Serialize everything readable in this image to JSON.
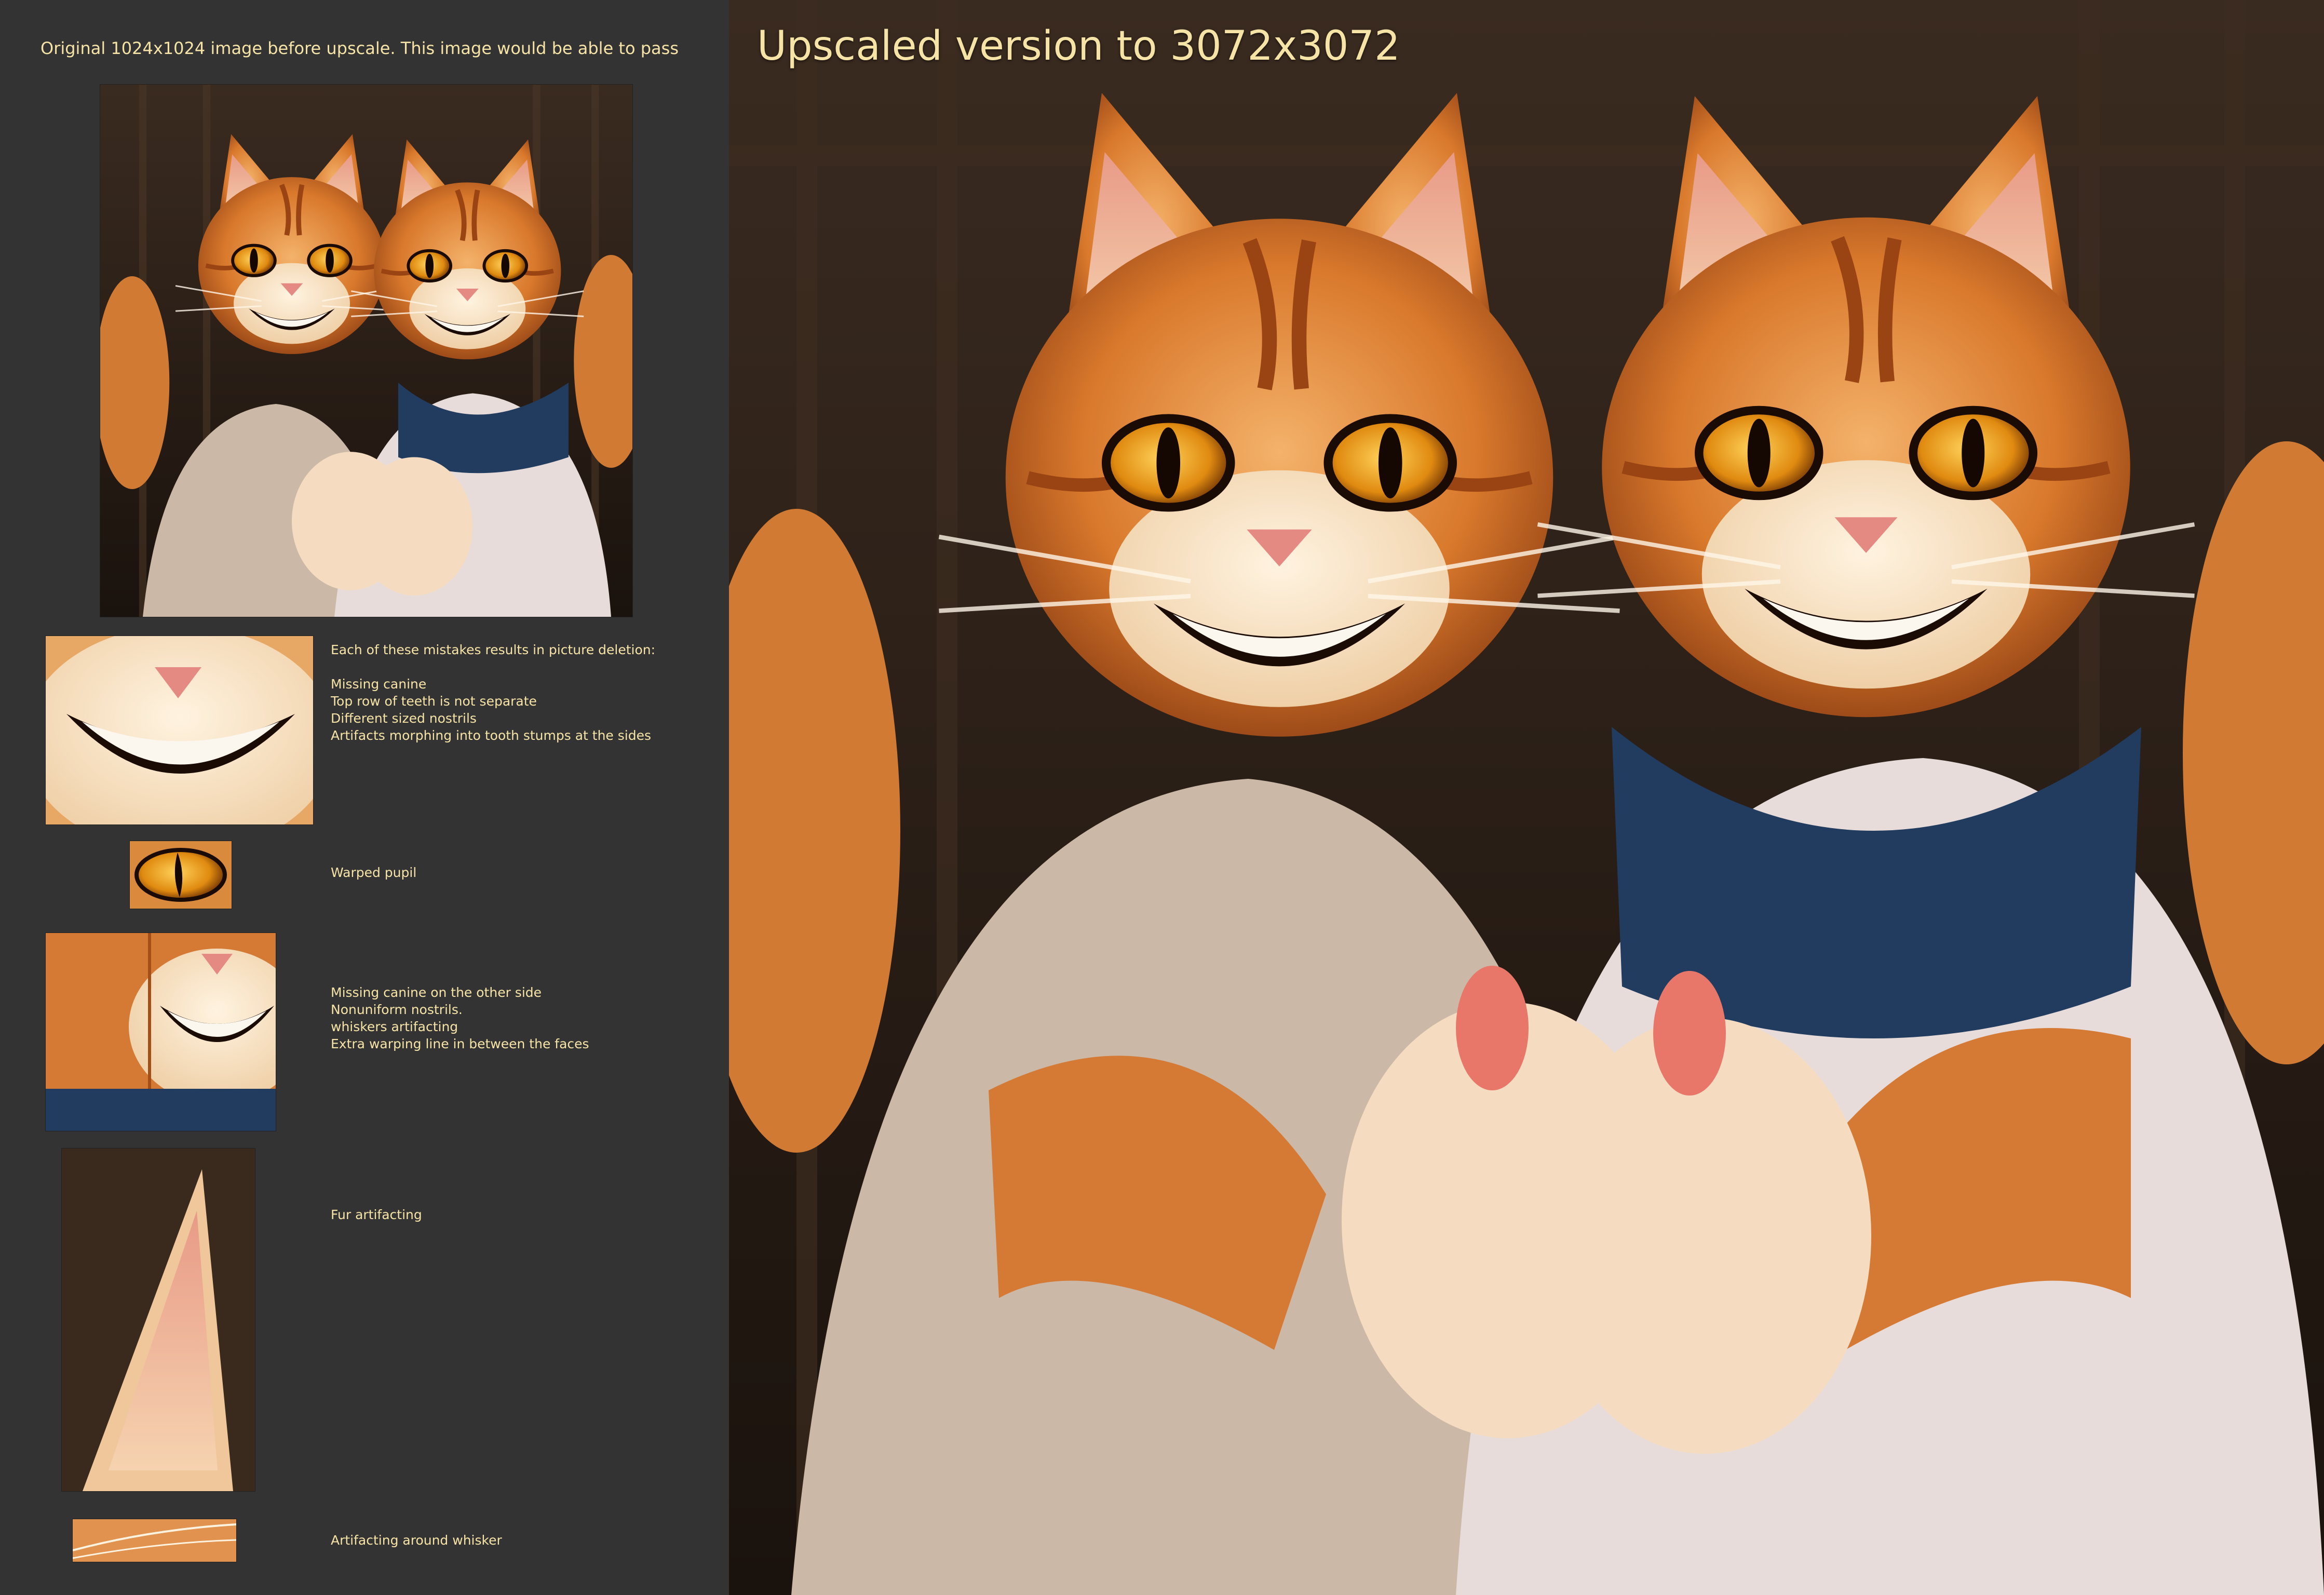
{
  "left": {
    "caption": "Original 1024x1024 image before upscale. This image would be able to pass",
    "notes": [
      {
        "id": "teeth",
        "text": "Each of these mistakes results in picture deletion:\n\nMissing canine\nTop row of teeth is not separate\nDifferent sized nostrils\nArtifacts morphing into tooth stumps at the sides"
      },
      {
        "id": "pupil",
        "text": "Warped pupil"
      },
      {
        "id": "faces",
        "text": "Missing canine on the other side\nNonuniform nostrils.\nwhiskers artifacting\nExtra warping line in between the faces"
      },
      {
        "id": "fur",
        "text": "Fur artifacting"
      },
      {
        "id": "whisker",
        "text": "Artifacting around whisker"
      }
    ]
  },
  "right": {
    "title": "Upscaled version to 3072x3072"
  },
  "colors": {
    "panel_bg": "#333333",
    "text": "#f6e4a6",
    "fur_orange": "#d9792c",
    "fur_light": "#f2d2a8",
    "scarf": "#213c5e",
    "shirt_left": "#cbb8a6",
    "shirt_right": "#e7dcd9",
    "background_wood": "#2a1f18"
  }
}
